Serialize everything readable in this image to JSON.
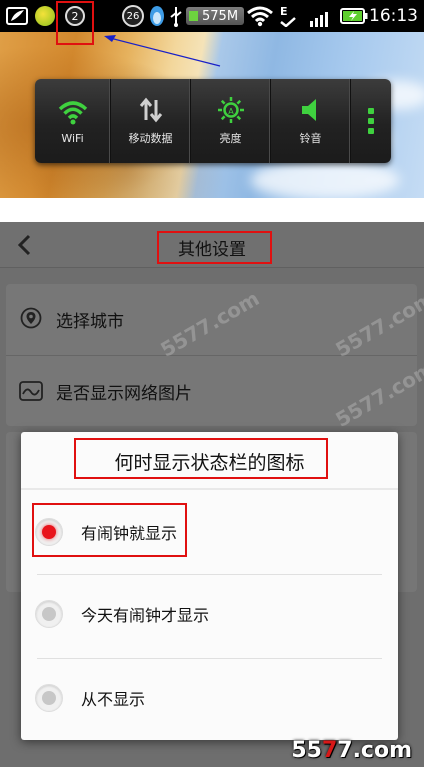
{
  "status_bar": {
    "notification_badge": "2",
    "circle_badge": "26",
    "memory": "575M",
    "data_letter": "E",
    "time": "16:13"
  },
  "quick_toggles": [
    {
      "label": "WiFi",
      "icon": "wifi-icon",
      "color": "#3fd13f"
    },
    {
      "label": "移动数据",
      "icon": "mobile-data-icon",
      "color": "#d0d0d0"
    },
    {
      "label": "亮度",
      "icon": "brightness-icon",
      "color": "#3fd13f"
    },
    {
      "label": "铃音",
      "icon": "ringtone-icon",
      "color": "#3fd13f"
    }
  ],
  "settings_page": {
    "title": "其他设置",
    "items": [
      {
        "label": "选择城市",
        "icon": "location-pin-icon"
      },
      {
        "label": "是否显示网络图片",
        "icon": "image-icon"
      }
    ]
  },
  "dialog": {
    "title": "何时显示状态栏的图标",
    "options": [
      {
        "label": "有闹钟就显示",
        "checked": true
      },
      {
        "label": "今天有闹钟才显示",
        "checked": false
      },
      {
        "label": "从不显示",
        "checked": false
      }
    ]
  },
  "watermark": "5577.com",
  "logo": {
    "num1": "55",
    "num2": "7",
    "num3": "7",
    "suffix": ".com"
  },
  "colors": {
    "highlight": "#e01010",
    "accent_green": "#3fd13f",
    "radio_selected": "#e8141c"
  }
}
